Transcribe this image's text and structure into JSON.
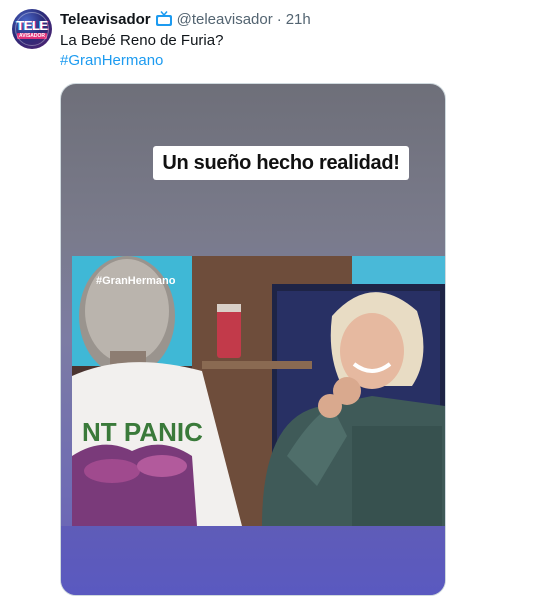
{
  "tweet": {
    "display_name": "Teleavisador",
    "handle": "@teleavisador",
    "separator": "·",
    "time": "21h",
    "text": "La Bebé Reno de Furia?",
    "hashtag": "#GranHermano"
  },
  "avatar": {
    "logo_top": "TELE",
    "logo_bottom": "AVISADOR"
  },
  "badge_icon": "tv-icon",
  "media": {
    "caption": "Un sueño hecho realidad!",
    "watermark": "#GranHermano",
    "shirt_text": "NT PANIC"
  },
  "colors": {
    "link": "#1d9bf0",
    "secondary": "#536471",
    "badge": "#1d9bf0"
  }
}
